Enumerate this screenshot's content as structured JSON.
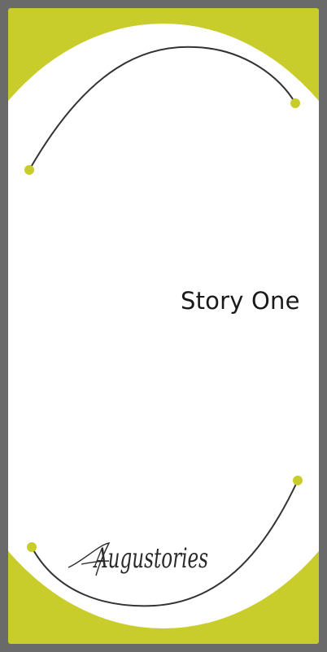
{
  "card": {
    "title": "Story One",
    "brand": "Augustories"
  },
  "colors": {
    "frame": "#6a6a6a",
    "accent": "#c9cd2c",
    "page": "#ffffff",
    "line": "#333333"
  }
}
